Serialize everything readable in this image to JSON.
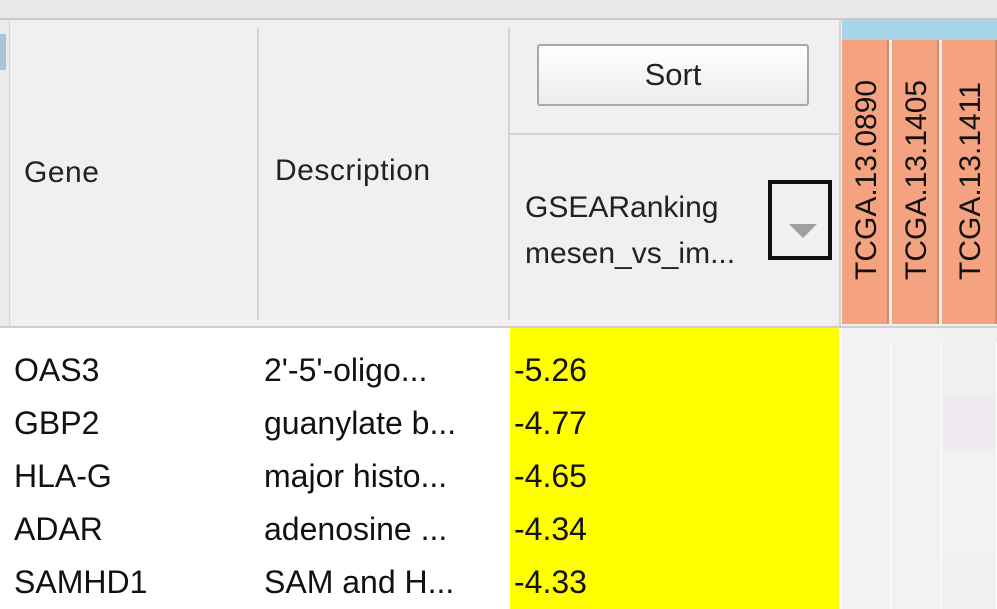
{
  "header": {
    "gene_label": "Gene",
    "description_label": "Description",
    "sort_label": "Sort",
    "ranking_line1": "GSEARanking",
    "ranking_line2": "mesen_vs_im...",
    "samples": [
      "TCGA.13.0890",
      "TCGA.13.1405",
      "TCGA.13.1411"
    ]
  },
  "colors": {
    "sample_header": "#f4a27f",
    "score_highlight": "#ffff00",
    "header_bg": "#f0f0f0"
  },
  "rows": [
    {
      "gene": "OAS3",
      "description": "2'-5'-oligo...",
      "score": "-5.26",
      "heat": [
        "#f4f2f4",
        "#f1f3f1",
        "#eff1ef"
      ]
    },
    {
      "gene": "GBP2",
      "description": "guanylate b...",
      "score": "-4.77",
      "heat": [
        "#f4f2f4",
        "#f1f3f1",
        "#eeeaf0"
      ]
    },
    {
      "gene": "HLA-G",
      "description": "major histo...",
      "score": "-4.65",
      "heat": [
        "#f4f2f4",
        "#f1f3f1",
        "#f2f1f3"
      ]
    },
    {
      "gene": "ADAR",
      "description": "adenosine ...",
      "score": "-4.34",
      "heat": [
        "#f4f2f4",
        "#f1f3f1",
        "#f2f1f3"
      ]
    },
    {
      "gene": "SAMHD1",
      "description": "SAM and H...",
      "score": "-4.33",
      "heat": [
        "#f4f2f4",
        "#f1f3f1",
        "#eff1ef"
      ]
    }
  ]
}
